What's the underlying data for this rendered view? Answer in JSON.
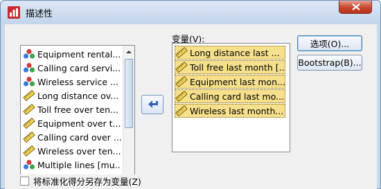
{
  "window": {
    "title": "描述性",
    "icon": "spss-dialog-icon",
    "close_icon": "close-icon"
  },
  "source_list": {
    "items": [
      {
        "label": "Equipment rental...",
        "icon": "nominal-icon"
      },
      {
        "label": "Calling card servi...",
        "icon": "nominal-icon"
      },
      {
        "label": "Wireless service ...",
        "icon": "nominal-icon"
      },
      {
        "label": "Long distance ov...",
        "icon": "scale-ruler-icon"
      },
      {
        "label": "Toll free over ten...",
        "icon": "scale-ruler-icon"
      },
      {
        "label": "Equipment over t...",
        "icon": "scale-ruler-icon"
      },
      {
        "label": "Calling card over ...",
        "icon": "scale-ruler-icon"
      },
      {
        "label": "Wireless over ten...",
        "icon": "scale-ruler-icon"
      },
      {
        "label": "Multiple lines [mu...",
        "icon": "nominal-icon"
      }
    ]
  },
  "move_button": {
    "icon": "arrow-left-icon"
  },
  "target": {
    "label": "变量(V):",
    "items": [
      {
        "label": "Long distance last ..."
      },
      {
        "label": "Toll free last month [..."
      },
      {
        "label": "Equipment last mon..."
      },
      {
        "label": "Calling card last mo..."
      },
      {
        "label": "Wireless last month..."
      }
    ]
  },
  "buttons": {
    "options": "选项(O)...",
    "bootstrap": "Bootstrap(B)..."
  },
  "bottom": {
    "save_standardized_label": "将标准化得分另存为变量(Z)",
    "checked": false
  },
  "colors": {
    "selection": "#f6e08c",
    "title_bg": "#c9d9ec",
    "close_red": "#c7442c"
  }
}
